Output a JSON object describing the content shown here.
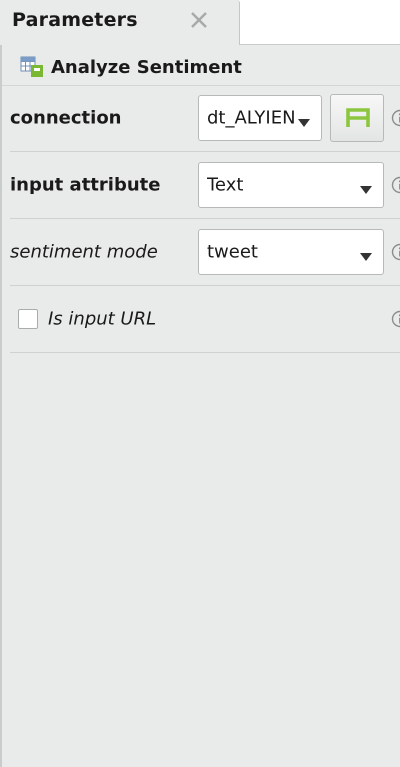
{
  "tab": {
    "title": "Parameters",
    "close_icon": "close-icon"
  },
  "operator": {
    "title": "Analyze Sentiment",
    "icon": "operator-icon"
  },
  "params": {
    "connection": {
      "label": "connection",
      "value": "dt_ALYIEN",
      "button_icon": "connection-icon"
    },
    "input_attribute": {
      "label": "input attribute",
      "value": "Text"
    },
    "sentiment_mode": {
      "label": "sentiment mode",
      "value": "tweet"
    },
    "is_input_url": {
      "label": "Is input URL",
      "checked": false
    }
  },
  "colors": {
    "panel_background": "#e9ebea",
    "accent_green": "#8cc63f"
  }
}
